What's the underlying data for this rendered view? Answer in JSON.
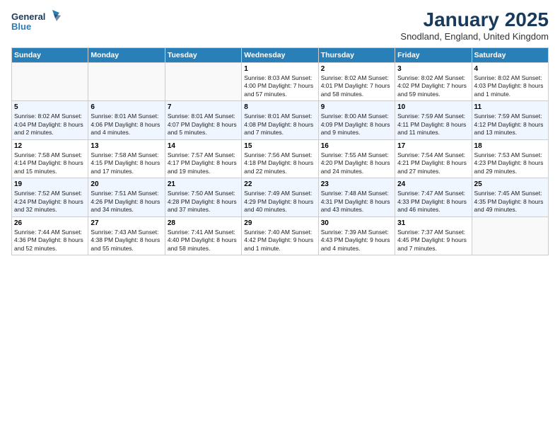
{
  "header": {
    "logo_line1": "General",
    "logo_line2": "Blue",
    "title": "January 2025",
    "location": "Snodland, England, United Kingdom"
  },
  "days_of_week": [
    "Sunday",
    "Monday",
    "Tuesday",
    "Wednesday",
    "Thursday",
    "Friday",
    "Saturday"
  ],
  "weeks": [
    [
      {
        "day": "",
        "info": ""
      },
      {
        "day": "",
        "info": ""
      },
      {
        "day": "",
        "info": ""
      },
      {
        "day": "1",
        "info": "Sunrise: 8:03 AM\nSunset: 4:00 PM\nDaylight: 7 hours and 57 minutes."
      },
      {
        "day": "2",
        "info": "Sunrise: 8:02 AM\nSunset: 4:01 PM\nDaylight: 7 hours and 58 minutes."
      },
      {
        "day": "3",
        "info": "Sunrise: 8:02 AM\nSunset: 4:02 PM\nDaylight: 7 hours and 59 minutes."
      },
      {
        "day": "4",
        "info": "Sunrise: 8:02 AM\nSunset: 4:03 PM\nDaylight: 8 hours and 1 minute."
      }
    ],
    [
      {
        "day": "5",
        "info": "Sunrise: 8:02 AM\nSunset: 4:04 PM\nDaylight: 8 hours and 2 minutes."
      },
      {
        "day": "6",
        "info": "Sunrise: 8:01 AM\nSunset: 4:06 PM\nDaylight: 8 hours and 4 minutes."
      },
      {
        "day": "7",
        "info": "Sunrise: 8:01 AM\nSunset: 4:07 PM\nDaylight: 8 hours and 5 minutes."
      },
      {
        "day": "8",
        "info": "Sunrise: 8:01 AM\nSunset: 4:08 PM\nDaylight: 8 hours and 7 minutes."
      },
      {
        "day": "9",
        "info": "Sunrise: 8:00 AM\nSunset: 4:09 PM\nDaylight: 8 hours and 9 minutes."
      },
      {
        "day": "10",
        "info": "Sunrise: 7:59 AM\nSunset: 4:11 PM\nDaylight: 8 hours and 11 minutes."
      },
      {
        "day": "11",
        "info": "Sunrise: 7:59 AM\nSunset: 4:12 PM\nDaylight: 8 hours and 13 minutes."
      }
    ],
    [
      {
        "day": "12",
        "info": "Sunrise: 7:58 AM\nSunset: 4:14 PM\nDaylight: 8 hours and 15 minutes."
      },
      {
        "day": "13",
        "info": "Sunrise: 7:58 AM\nSunset: 4:15 PM\nDaylight: 8 hours and 17 minutes."
      },
      {
        "day": "14",
        "info": "Sunrise: 7:57 AM\nSunset: 4:17 PM\nDaylight: 8 hours and 19 minutes."
      },
      {
        "day": "15",
        "info": "Sunrise: 7:56 AM\nSunset: 4:18 PM\nDaylight: 8 hours and 22 minutes."
      },
      {
        "day": "16",
        "info": "Sunrise: 7:55 AM\nSunset: 4:20 PM\nDaylight: 8 hours and 24 minutes."
      },
      {
        "day": "17",
        "info": "Sunrise: 7:54 AM\nSunset: 4:21 PM\nDaylight: 8 hours and 27 minutes."
      },
      {
        "day": "18",
        "info": "Sunrise: 7:53 AM\nSunset: 4:23 PM\nDaylight: 8 hours and 29 minutes."
      }
    ],
    [
      {
        "day": "19",
        "info": "Sunrise: 7:52 AM\nSunset: 4:24 PM\nDaylight: 8 hours and 32 minutes."
      },
      {
        "day": "20",
        "info": "Sunrise: 7:51 AM\nSunset: 4:26 PM\nDaylight: 8 hours and 34 minutes."
      },
      {
        "day": "21",
        "info": "Sunrise: 7:50 AM\nSunset: 4:28 PM\nDaylight: 8 hours and 37 minutes."
      },
      {
        "day": "22",
        "info": "Sunrise: 7:49 AM\nSunset: 4:29 PM\nDaylight: 8 hours and 40 minutes."
      },
      {
        "day": "23",
        "info": "Sunrise: 7:48 AM\nSunset: 4:31 PM\nDaylight: 8 hours and 43 minutes."
      },
      {
        "day": "24",
        "info": "Sunrise: 7:47 AM\nSunset: 4:33 PM\nDaylight: 8 hours and 46 minutes."
      },
      {
        "day": "25",
        "info": "Sunrise: 7:45 AM\nSunset: 4:35 PM\nDaylight: 8 hours and 49 minutes."
      }
    ],
    [
      {
        "day": "26",
        "info": "Sunrise: 7:44 AM\nSunset: 4:36 PM\nDaylight: 8 hours and 52 minutes."
      },
      {
        "day": "27",
        "info": "Sunrise: 7:43 AM\nSunset: 4:38 PM\nDaylight: 8 hours and 55 minutes."
      },
      {
        "day": "28",
        "info": "Sunrise: 7:41 AM\nSunset: 4:40 PM\nDaylight: 8 hours and 58 minutes."
      },
      {
        "day": "29",
        "info": "Sunrise: 7:40 AM\nSunset: 4:42 PM\nDaylight: 9 hours and 1 minute."
      },
      {
        "day": "30",
        "info": "Sunrise: 7:39 AM\nSunset: 4:43 PM\nDaylight: 9 hours and 4 minutes."
      },
      {
        "day": "31",
        "info": "Sunrise: 7:37 AM\nSunset: 4:45 PM\nDaylight: 9 hours and 7 minutes."
      },
      {
        "day": "",
        "info": ""
      }
    ]
  ]
}
